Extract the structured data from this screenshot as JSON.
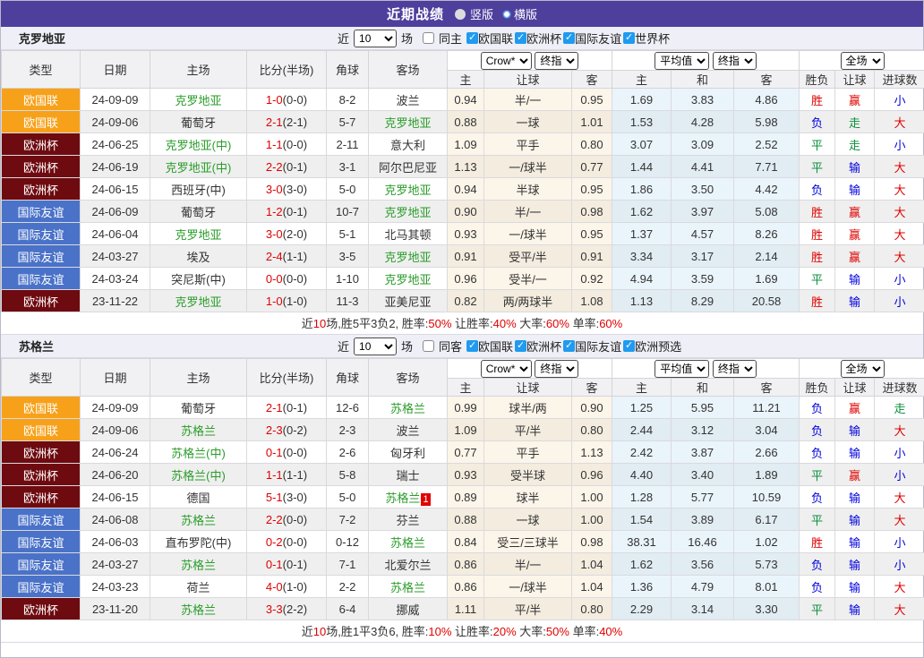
{
  "banner": {
    "title": "近期战绩",
    "vertical_label": "竖版",
    "horizontal_label": "横版"
  },
  "columns": {
    "type": "类型",
    "date": "日期",
    "home": "主场",
    "score": "比分(半场)",
    "corner": "角球",
    "away": "客场",
    "sub_home": "主",
    "sub_handicap": "让球",
    "sub_away": "客",
    "sub_avg_home": "主",
    "sub_avg_draw": "和",
    "sub_avg_away": "客",
    "sub_result": "胜负",
    "sub_handicap_result": "让球",
    "sub_goals": "进球数"
  },
  "dropdowns": {
    "odds_provider": "Crow*",
    "final_a": "终指",
    "average": "平均值",
    "final_b": "终指",
    "full_match": "全场"
  },
  "league_colors": {
    "欧国联": "#f7a11a",
    "欧洲杯": "#6e0b10",
    "国际友谊": "#4a72c8"
  },
  "result_colors": {
    "胜": "#e00000",
    "负": "#0000dd",
    "平": "#0a8f3c",
    "赢": "#e00000",
    "输": "#0000dd",
    "走": "#0a8f3c",
    "大": "#e00000",
    "小": "#0000dd"
  },
  "sections": [
    {
      "team": "克罗地亚",
      "filter": {
        "near": "近",
        "count": "10",
        "games": "场",
        "same": "同主",
        "leagues": [
          "欧国联",
          "欧洲杯",
          "国际友谊",
          "世界杯"
        ]
      },
      "rows": [
        {
          "league": "欧国联",
          "date": "24-09-09",
          "home": "克罗地亚",
          "home_hl": true,
          "score": "1-0",
          "half": "(0-0)",
          "corners": "8-2",
          "away": "波兰",
          "away_hl": false,
          "away_badge": "",
          "o_home": "0.94",
          "o_handicap": "半/一",
          "o_away": "0.95",
          "a_home": "1.69",
          "a_draw": "3.83",
          "a_away": "4.86",
          "res": "胜",
          "h_res": "赢",
          "g_res": "小"
        },
        {
          "league": "欧国联",
          "date": "24-09-06",
          "home": "葡萄牙",
          "home_hl": false,
          "score": "2-1",
          "half": "(2-1)",
          "corners": "5-7",
          "away": "克罗地亚",
          "away_hl": true,
          "away_badge": "",
          "o_home": "0.88",
          "o_handicap": "一球",
          "o_away": "1.01",
          "a_home": "1.53",
          "a_draw": "4.28",
          "a_away": "5.98",
          "res": "负",
          "h_res": "走",
          "g_res": "大"
        },
        {
          "league": "欧洲杯",
          "date": "24-06-25",
          "home": "克罗地亚(中)",
          "home_hl": true,
          "score": "1-1",
          "half": "(0-0)",
          "corners": "2-11",
          "away": "意大利",
          "away_hl": false,
          "away_badge": "",
          "o_home": "1.09",
          "o_handicap": "平手",
          "o_away": "0.80",
          "a_home": "3.07",
          "a_draw": "3.09",
          "a_away": "2.52",
          "res": "平",
          "h_res": "走",
          "g_res": "小"
        },
        {
          "league": "欧洲杯",
          "date": "24-06-19",
          "home": "克罗地亚(中)",
          "home_hl": true,
          "score": "2-2",
          "half": "(0-1)",
          "corners": "3-1",
          "away": "阿尔巴尼亚",
          "away_hl": false,
          "away_badge": "",
          "o_home": "1.13",
          "o_handicap": "一/球半",
          "o_away": "0.77",
          "a_home": "1.44",
          "a_draw": "4.41",
          "a_away": "7.71",
          "res": "平",
          "h_res": "输",
          "g_res": "大"
        },
        {
          "league": "欧洲杯",
          "date": "24-06-15",
          "home": "西班牙(中)",
          "home_hl": false,
          "score": "3-0",
          "half": "(3-0)",
          "corners": "5-0",
          "away": "克罗地亚",
          "away_hl": true,
          "away_badge": "",
          "o_home": "0.94",
          "o_handicap": "半球",
          "o_away": "0.95",
          "a_home": "1.86",
          "a_draw": "3.50",
          "a_away": "4.42",
          "res": "负",
          "h_res": "输",
          "g_res": "大"
        },
        {
          "league": "国际友谊",
          "date": "24-06-09",
          "home": "葡萄牙",
          "home_hl": false,
          "score": "1-2",
          "half": "(0-1)",
          "corners": "10-7",
          "away": "克罗地亚",
          "away_hl": true,
          "away_badge": "",
          "o_home": "0.90",
          "o_handicap": "半/一",
          "o_away": "0.98",
          "a_home": "1.62",
          "a_draw": "3.97",
          "a_away": "5.08",
          "res": "胜",
          "h_res": "赢",
          "g_res": "大"
        },
        {
          "league": "国际友谊",
          "date": "24-06-04",
          "home": "克罗地亚",
          "home_hl": true,
          "score": "3-0",
          "half": "(2-0)",
          "corners": "5-1",
          "away": "北马其顿",
          "away_hl": false,
          "away_badge": "",
          "o_home": "0.93",
          "o_handicap": "一/球半",
          "o_away": "0.95",
          "a_home": "1.37",
          "a_draw": "4.57",
          "a_away": "8.26",
          "res": "胜",
          "h_res": "赢",
          "g_res": "大"
        },
        {
          "league": "国际友谊",
          "date": "24-03-27",
          "home": "埃及",
          "home_hl": false,
          "score": "2-4",
          "half": "(1-1)",
          "corners": "3-5",
          "away": "克罗地亚",
          "away_hl": true,
          "away_badge": "",
          "o_home": "0.91",
          "o_handicap": "受平/半",
          "o_away": "0.91",
          "a_home": "3.34",
          "a_draw": "3.17",
          "a_away": "2.14",
          "res": "胜",
          "h_res": "赢",
          "g_res": "大"
        },
        {
          "league": "国际友谊",
          "date": "24-03-24",
          "home": "突尼斯(中)",
          "home_hl": false,
          "score": "0-0",
          "half": "(0-0)",
          "corners": "1-10",
          "away": "克罗地亚",
          "away_hl": true,
          "away_badge": "",
          "o_home": "0.96",
          "o_handicap": "受半/一",
          "o_away": "0.92",
          "a_home": "4.94",
          "a_draw": "3.59",
          "a_away": "1.69",
          "res": "平",
          "h_res": "输",
          "g_res": "小"
        },
        {
          "league": "欧洲杯",
          "date": "23-11-22",
          "home": "克罗地亚",
          "home_hl": true,
          "score": "1-0",
          "half": "(1-0)",
          "corners": "11-3",
          "away": "亚美尼亚",
          "away_hl": false,
          "away_badge": "",
          "o_home": "0.82",
          "o_handicap": "两/两球半",
          "o_away": "1.08",
          "a_home": "1.13",
          "a_draw": "8.29",
          "a_away": "20.58",
          "res": "胜",
          "h_res": "输",
          "g_res": "小"
        }
      ],
      "summary": [
        {
          "text": "近",
          "red": false
        },
        {
          "text": "10",
          "red": true
        },
        {
          "text": "场,胜5平3负2, 胜率:",
          "red": false
        },
        {
          "text": "50%",
          "red": true
        },
        {
          "text": " 让胜率:",
          "red": false
        },
        {
          "text": "40%",
          "red": true
        },
        {
          "text": " 大率:",
          "red": false
        },
        {
          "text": "60%",
          "red": true
        },
        {
          "text": " 单率:",
          "red": false
        },
        {
          "text": "60%",
          "red": true
        }
      ]
    },
    {
      "team": "苏格兰",
      "filter": {
        "near": "近",
        "count": "10",
        "games": "场",
        "same": "同客",
        "leagues": [
          "欧国联",
          "欧洲杯",
          "国际友谊",
          "欧洲预选"
        ]
      },
      "rows": [
        {
          "league": "欧国联",
          "date": "24-09-09",
          "home": "葡萄牙",
          "home_hl": false,
          "score": "2-1",
          "half": "(0-1)",
          "corners": "12-6",
          "away": "苏格兰",
          "away_hl": true,
          "away_badge": "",
          "o_home": "0.99",
          "o_handicap": "球半/两",
          "o_away": "0.90",
          "a_home": "1.25",
          "a_draw": "5.95",
          "a_away": "11.21",
          "res": "负",
          "h_res": "赢",
          "g_res": "走"
        },
        {
          "league": "欧国联",
          "date": "24-09-06",
          "home": "苏格兰",
          "home_hl": true,
          "score": "2-3",
          "half": "(0-2)",
          "corners": "2-3",
          "away": "波兰",
          "away_hl": false,
          "away_badge": "",
          "o_home": "1.09",
          "o_handicap": "平/半",
          "o_away": "0.80",
          "a_home": "2.44",
          "a_draw": "3.12",
          "a_away": "3.04",
          "res": "负",
          "h_res": "输",
          "g_res": "大"
        },
        {
          "league": "欧洲杯",
          "date": "24-06-24",
          "home": "苏格兰(中)",
          "home_hl": true,
          "score": "0-1",
          "half": "(0-0)",
          "corners": "2-6",
          "away": "匈牙利",
          "away_hl": false,
          "away_badge": "",
          "o_home": "0.77",
          "o_handicap": "平手",
          "o_away": "1.13",
          "a_home": "2.42",
          "a_draw": "3.87",
          "a_away": "2.66",
          "res": "负",
          "h_res": "输",
          "g_res": "小"
        },
        {
          "league": "欧洲杯",
          "date": "24-06-20",
          "home": "苏格兰(中)",
          "home_hl": true,
          "score": "1-1",
          "half": "(1-1)",
          "corners": "5-8",
          "away": "瑞士",
          "away_hl": false,
          "away_badge": "",
          "o_home": "0.93",
          "o_handicap": "受半球",
          "o_away": "0.96",
          "a_home": "4.40",
          "a_draw": "3.40",
          "a_away": "1.89",
          "res": "平",
          "h_res": "赢",
          "g_res": "小"
        },
        {
          "league": "欧洲杯",
          "date": "24-06-15",
          "home": "德国",
          "home_hl": false,
          "score": "5-1",
          "half": "(3-0)",
          "corners": "5-0",
          "away": "苏格兰",
          "away_hl": true,
          "away_badge": "1",
          "o_home": "0.89",
          "o_handicap": "球半",
          "o_away": "1.00",
          "a_home": "1.28",
          "a_draw": "5.77",
          "a_away": "10.59",
          "res": "负",
          "h_res": "输",
          "g_res": "大"
        },
        {
          "league": "国际友谊",
          "date": "24-06-08",
          "home": "苏格兰",
          "home_hl": true,
          "score": "2-2",
          "half": "(0-0)",
          "corners": "7-2",
          "away": "芬兰",
          "away_hl": false,
          "away_badge": "",
          "o_home": "0.88",
          "o_handicap": "一球",
          "o_away": "1.00",
          "a_home": "1.54",
          "a_draw": "3.89",
          "a_away": "6.17",
          "res": "平",
          "h_res": "输",
          "g_res": "大"
        },
        {
          "league": "国际友谊",
          "date": "24-06-03",
          "home": "直布罗陀(中)",
          "home_hl": false,
          "score": "0-2",
          "half": "(0-0)",
          "corners": "0-12",
          "away": "苏格兰",
          "away_hl": true,
          "away_badge": "",
          "o_home": "0.84",
          "o_handicap": "受三/三球半",
          "o_away": "0.98",
          "a_home": "38.31",
          "a_draw": "16.46",
          "a_away": "1.02",
          "res": "胜",
          "h_res": "输",
          "g_res": "小"
        },
        {
          "league": "国际友谊",
          "date": "24-03-27",
          "home": "苏格兰",
          "home_hl": true,
          "score": "0-1",
          "half": "(0-1)",
          "corners": "7-1",
          "away": "北爱尔兰",
          "away_hl": false,
          "away_badge": "",
          "o_home": "0.86",
          "o_handicap": "半/一",
          "o_away": "1.04",
          "a_home": "1.62",
          "a_draw": "3.56",
          "a_away": "5.73",
          "res": "负",
          "h_res": "输",
          "g_res": "小"
        },
        {
          "league": "国际友谊",
          "date": "24-03-23",
          "home": "荷兰",
          "home_hl": false,
          "score": "4-0",
          "half": "(1-0)",
          "corners": "2-2",
          "away": "苏格兰",
          "away_hl": true,
          "away_badge": "",
          "o_home": "0.86",
          "o_handicap": "一/球半",
          "o_away": "1.04",
          "a_home": "1.36",
          "a_draw": "4.79",
          "a_away": "8.01",
          "res": "负",
          "h_res": "输",
          "g_res": "大"
        },
        {
          "league": "欧洲杯",
          "date": "23-11-20",
          "home": "苏格兰",
          "home_hl": true,
          "score": "3-3",
          "half": "(2-2)",
          "corners": "6-4",
          "away": "挪威",
          "away_hl": false,
          "away_badge": "",
          "o_home": "1.11",
          "o_handicap": "平/半",
          "o_away": "0.80",
          "a_home": "2.29",
          "a_draw": "3.14",
          "a_away": "3.30",
          "res": "平",
          "h_res": "输",
          "g_res": "大"
        }
      ],
      "summary": [
        {
          "text": "近",
          "red": false
        },
        {
          "text": "10",
          "red": true
        },
        {
          "text": "场,胜1平3负6, 胜率:",
          "red": false
        },
        {
          "text": "10%",
          "red": true
        },
        {
          "text": " 让胜率:",
          "red": false
        },
        {
          "text": "20%",
          "red": true
        },
        {
          "text": " 大率:",
          "red": false
        },
        {
          "text": "50%",
          "red": true
        },
        {
          "text": " 单率:",
          "red": false
        },
        {
          "text": "40%",
          "red": true
        }
      ]
    }
  ]
}
